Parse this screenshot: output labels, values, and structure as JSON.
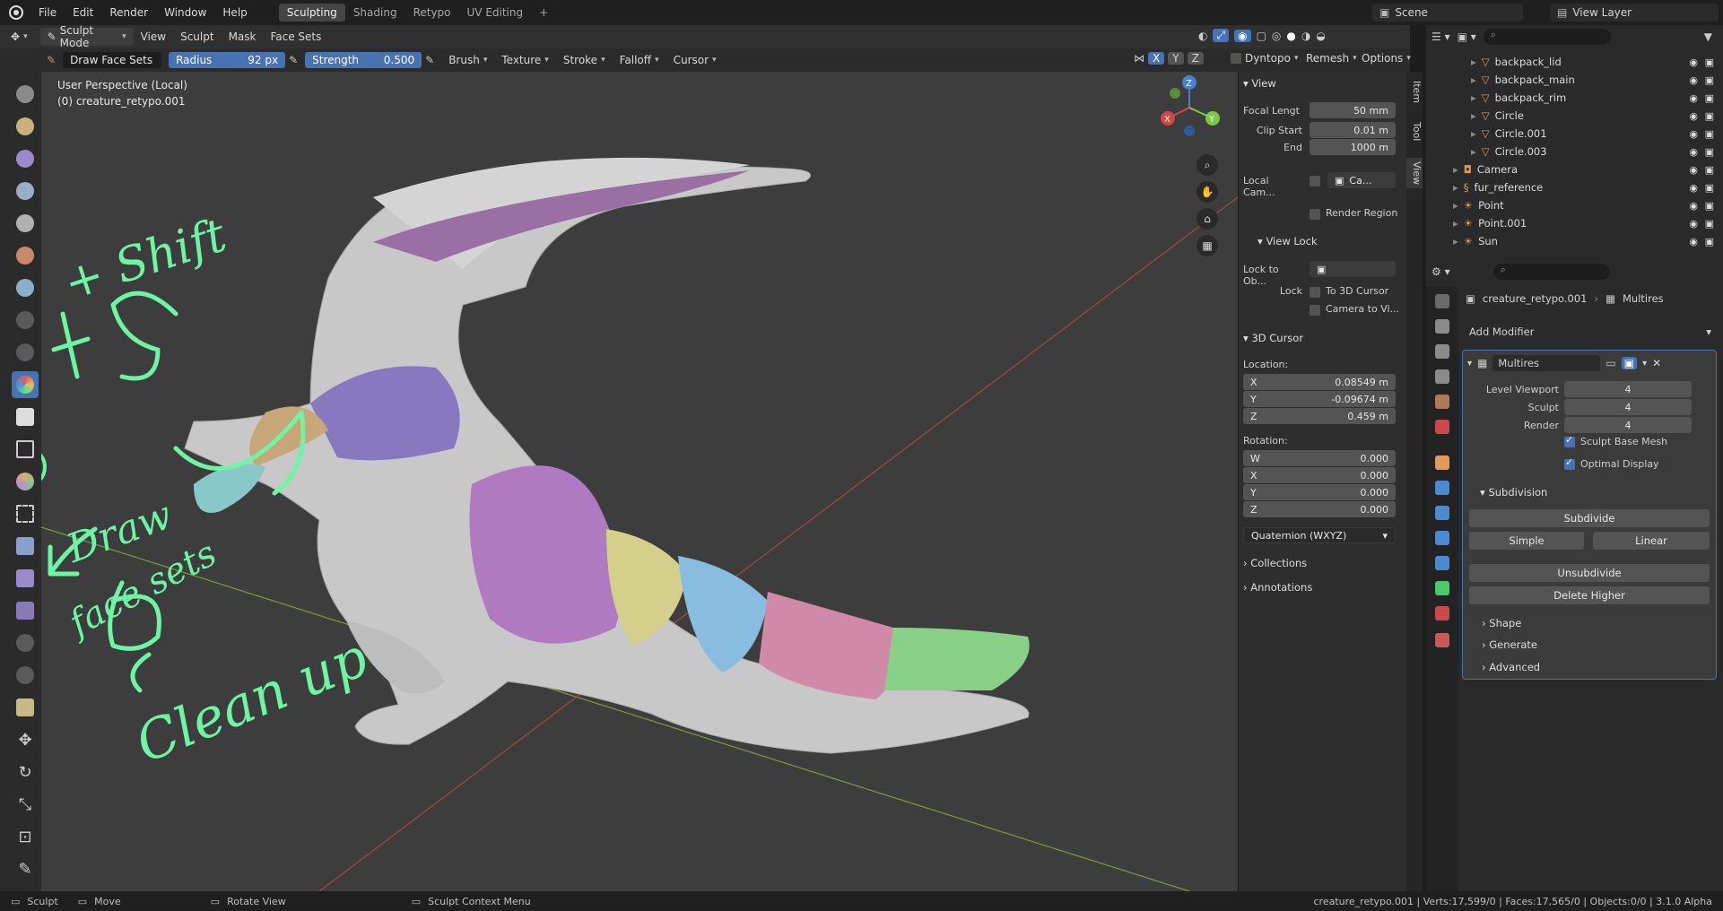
{
  "menu": {
    "file": "File",
    "edit": "Edit",
    "render": "Render",
    "window": "Window",
    "help": "Help"
  },
  "workspaces": [
    {
      "label": "Sculpting",
      "active": true
    },
    {
      "label": "Shading",
      "active": false
    },
    {
      "label": "Retypo",
      "active": false
    },
    {
      "label": "UV Editing",
      "active": false
    }
  ],
  "scene": {
    "name": "Scene",
    "view_layer": "View Layer"
  },
  "header": {
    "mode": "Sculpt Mode",
    "view": "View",
    "sculpt": "Sculpt",
    "mask": "Mask",
    "face_sets": "Face Sets",
    "dyntopo": "Dyntopo",
    "remesh": "Remesh",
    "options": "Options",
    "x": "X",
    "y": "Y",
    "z": "Z"
  },
  "tool_settings": {
    "brush_name": "Draw Face Sets",
    "radius_label": "Radius",
    "radius_value": "92 px",
    "strength_label": "Strength",
    "strength_value": "0.500",
    "brush": "Brush",
    "texture": "Texture",
    "stroke": "Stroke",
    "falloff": "Falloff",
    "cursor": "Cursor"
  },
  "viewport": {
    "perspective": "User Perspective (Local)",
    "object": "(0) creature_retypo.001"
  },
  "annotations": {
    "shift": "+ Shift",
    "draw": "Draw",
    "facesets": "face sets",
    "cleanup": "Clean up"
  },
  "npanel": {
    "tabs": [
      "Item",
      "Tool",
      "View"
    ],
    "view_title": "View",
    "focal_label": "Focal Lengt",
    "focal_value": "50 mm",
    "clip_start_label": "Clip Start",
    "clip_start_value": "0.01 m",
    "end_label": "End",
    "end_value": "1000 m",
    "local_cam_label": "Local Cam...",
    "local_cam_value": "Ca...",
    "render_region": "Render Region",
    "view_lock_title": "View Lock",
    "lock_to_obj_label": "Lock to Ob...",
    "lock_label": "Lock",
    "to_3d_cursor": "To 3D Cursor",
    "camera_to_view": "Camera to Vi...",
    "cursor_title": "3D Cursor",
    "location_label": "Location:",
    "loc_x_label": "X",
    "loc_x": "0.08549 m",
    "loc_y_label": "Y",
    "loc_y": "-0.09674 m",
    "loc_z_label": "Z",
    "loc_z": "0.459 m",
    "rotation_label": "Rotation:",
    "rot_w_label": "W",
    "rot_w": "0.000",
    "rot_x_label": "X",
    "rot_x": "0.000",
    "rot_y_label": "Y",
    "rot_y": "0.000",
    "rot_z_label": "Z",
    "rot_z": "0.000",
    "rotation_mode": "Quaternion (WXYZ)",
    "collections": "Collections",
    "annotations": "Annotations"
  },
  "outliner": {
    "rows": [
      {
        "name": "backpack_lid"
      },
      {
        "name": "backpack_main"
      },
      {
        "name": "backpack_rim"
      },
      {
        "name": "Circle"
      },
      {
        "name": "Circle.001"
      },
      {
        "name": "Circle.003"
      },
      {
        "name": "Camera"
      },
      {
        "name": "fur_reference"
      },
      {
        "name": "Point"
      },
      {
        "name": "Point.001"
      },
      {
        "name": "Sun"
      }
    ]
  },
  "properties": {
    "breadcrumb_object": "creature_retypo.001",
    "breadcrumb_modifier": "Multires",
    "add_modifier": "Add Modifier",
    "modifier_name": "Multires",
    "level_viewport_label": "Level Viewport",
    "level_viewport": "4",
    "sculpt_label": "Sculpt",
    "sculpt": "4",
    "render_label": "Render",
    "render": "4",
    "sculpt_base_mesh": "Sculpt Base Mesh",
    "optimal_display": "Optimal Display",
    "subdivision_title": "Subdivision",
    "subdivide": "Subdivide",
    "simple": "Simple",
    "linear": "Linear",
    "unsubdivide": "Unsubdivide",
    "delete_higher": "Delete Higher",
    "shape": "Shape",
    "generate": "Generate",
    "advanced": "Advanced"
  },
  "status": {
    "sculpt": "Sculpt",
    "move": "Move",
    "rotate_view": "Rotate View",
    "context_menu": "Sculpt Context Menu",
    "stats": "creature_retypo.001 | Verts:17,599/0 | Faces:17,565/0 | Objects:0/0 | 3.1.0 Alpha"
  },
  "colors": {
    "accent": "#4772b3",
    "annotation": "#6df5a4",
    "viewport_bg": "#3d3d3d"
  }
}
